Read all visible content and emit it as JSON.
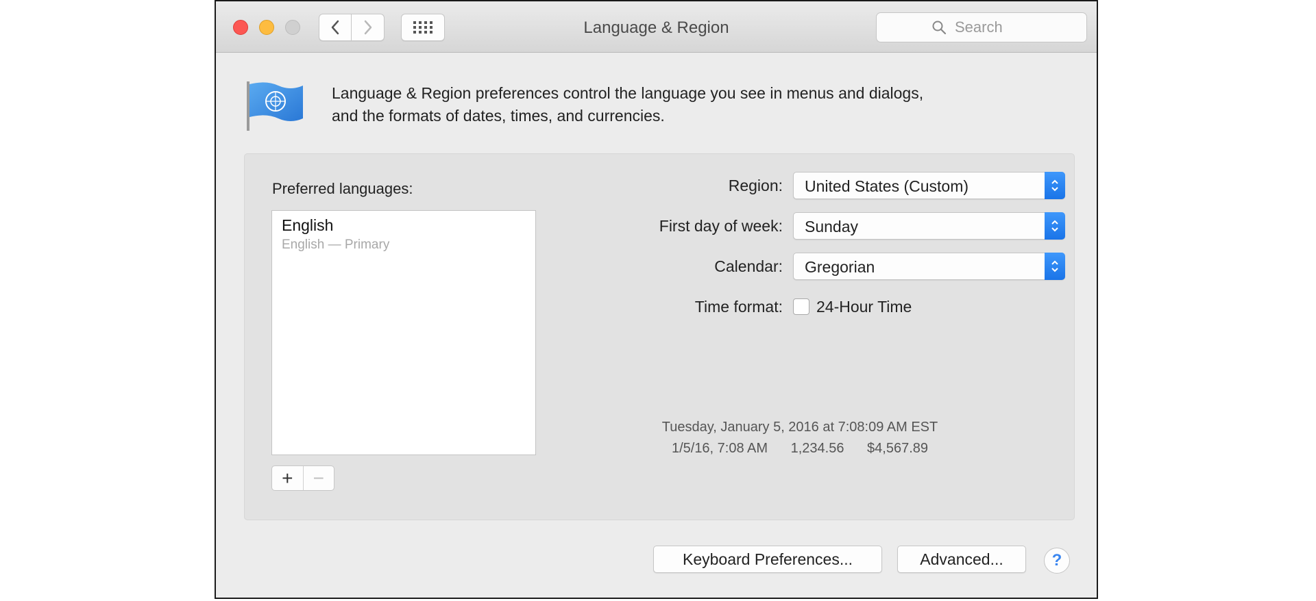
{
  "window": {
    "title": "Language & Region",
    "search_placeholder": "Search"
  },
  "toolbar": {
    "back_icon": "chevron-left-icon",
    "forward_icon": "chevron-right-icon",
    "grid_icon": "grid-icon"
  },
  "intro": {
    "line1": "Language & Region preferences control the language you see in menus and dialogs,",
    "line2": "and the formats of dates, times, and currencies."
  },
  "preferred_languages": {
    "label": "Preferred languages:",
    "items": [
      {
        "name": "English",
        "subtitle": "English — Primary"
      }
    ],
    "add_label": "+",
    "remove_label": "−"
  },
  "settings": {
    "region": {
      "label": "Region:",
      "value": "United States (Custom)"
    },
    "first_day": {
      "label": "First day of week:",
      "value": "Sunday"
    },
    "calendar": {
      "label": "Calendar:",
      "value": "Gregorian"
    },
    "time_format": {
      "label": "Time format:",
      "checkbox_label": "24-Hour Time",
      "checked": false
    }
  },
  "sample": {
    "long_date": "Tuesday, January 5, 2016 at 7:08:09 AM EST",
    "short_date": "1/5/16, 7:08 AM",
    "number": "1,234.56",
    "currency": "$4,567.89"
  },
  "buttons": {
    "keyboard": "Keyboard Preferences...",
    "advanced": "Advanced...",
    "help": "?"
  },
  "colors": {
    "close": "#fc5753",
    "minimize": "#fdbc40",
    "zoom": "#d0d0d0",
    "accent": "#1a74e8"
  }
}
